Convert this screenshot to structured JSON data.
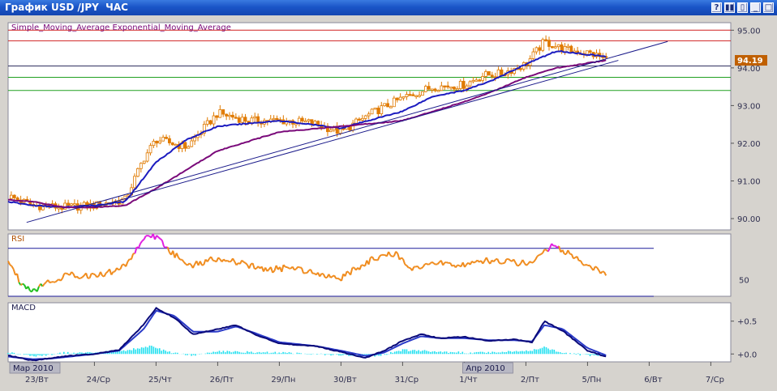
{
  "window": {
    "title": "График USD /JPY  ЧАС",
    "buttons": [
      {
        "name": "help-button",
        "glyph": "?"
      },
      {
        "name": "pause-button",
        "glyph": "▮▮"
      },
      {
        "name": "tile-button",
        "glyph": "▯"
      },
      {
        "name": "minimize-button",
        "glyph": "_"
      },
      {
        "name": "maximize-button",
        "glyph": "□"
      },
      {
        "name": "close-button",
        "glyph": "×"
      }
    ]
  },
  "price_panel": {
    "legend": "Simple_Moving_Average Exponential_Moving_Average",
    "current_price": "94.19",
    "y_ticks": [
      "95.00",
      "94.00",
      "93.00",
      "92.00",
      "91.00",
      "90.00"
    ]
  },
  "rsi_panel": {
    "label": "RSI",
    "y_ticks": [
      "50"
    ]
  },
  "macd_panel": {
    "label": "MACD",
    "y_ticks": [
      "+0.5",
      "+0.0"
    ]
  },
  "x_axis": {
    "labels": [
      "23/Вт",
      "24/Ср",
      "25/Чт",
      "26/Пт",
      "29/Пн",
      "30/Вт",
      "31/Ср",
      "1/Чт",
      "2/Пт",
      "5/Пн",
      "6/Вт",
      "7/Ср"
    ],
    "month_flags": [
      "Мар 2010",
      "Апр 2010"
    ]
  },
  "colors": {
    "background": "#ffffff",
    "candle": "#e07a00",
    "sma": "#1c1cc0",
    "ema": "#7a0a7a",
    "trendline": "#1a1a8a",
    "resistance": "#d02020",
    "support": "#20a020",
    "rsi_line": "#f08c1e",
    "rsi_high": "#e020e0",
    "rsi_low": "#20c020",
    "macd_line": "#0a0a7a",
    "signal_line": "#2a3ac8",
    "histogram": "#22e0f0",
    "price_badge": "#c06000"
  },
  "chart_data": [
    {
      "type": "candlestick",
      "title": "Simple_Moving_Average Exponential_Moving_Average",
      "ylim": [
        89.7,
        95.2
      ],
      "x": [
        "23/Вт",
        "24/Ср",
        "25/Чт",
        "26/Пт",
        "29/Пн",
        "30/Вт",
        "31/Ср",
        "1/Чт",
        "2/Пт",
        "5/Пн",
        "6/Вт"
      ],
      "series": [
        {
          "values": [
            90.35,
            90.3,
            91.9,
            92.9,
            92.6,
            92.4,
            93.2,
            93.55,
            93.95,
            94.65,
            94.25
          ]
        },
        {
          "values": [
            90.4,
            90.3,
            91.5,
            92.45,
            92.6,
            92.4,
            92.85,
            93.4,
            93.7,
            94.45,
            94.3
          ]
        },
        {
          "values": [
            90.55,
            90.3,
            90.8,
            91.8,
            92.3,
            92.45,
            92.6,
            93.1,
            93.4,
            93.95,
            94.2
          ]
        }
      ],
      "horizontal_levels": [
        95.0,
        94.72,
        94.05,
        93.75,
        93.4
      ],
      "trendline": [
        [
          22.9,
          89.9
        ],
        [
          28.6,
          94.7
        ]
      ],
      "last": 94.19
    },
    {
      "type": "line",
      "title": "RSI",
      "ylim": [
        30,
        82
      ],
      "levels": [
        70,
        30
      ],
      "x": [
        "23/Вт",
        "24/Ср",
        "25/Чт",
        "26/Пт",
        "29/Пн",
        "30/Вт",
        "31/Ср",
        "1/Чт",
        "2/Пт",
        "5/Пн",
        "6/Вт"
      ],
      "series": [
        {
          "values": [
            66,
            48,
            58,
            82,
            54,
            48,
            60,
            58,
            60,
            72,
            45
          ]
        }
      ]
    },
    {
      "type": "line",
      "title": "MACD",
      "ylim": [
        -0.12,
        0.78
      ],
      "x": [
        "23/Вт",
        "24/Ср",
        "25/Чт",
        "26/Пт",
        "29/Пн",
        "30/Вт",
        "31/Ср",
        "1/Чт",
        "2/Пт",
        "5/Пн",
        "6/Вт"
      ],
      "series": [
        {
          "values": [
            -0.05,
            0.02,
            0.68,
            0.4,
            0.18,
            0.05,
            0.25,
            0.22,
            0.2,
            0.48,
            0.0
          ]
        },
        {
          "values": [
            -0.08,
            0.0,
            0.64,
            0.38,
            0.17,
            0.06,
            0.22,
            0.21,
            0.2,
            0.44,
            0.02
          ]
        },
        {
          "values": [
            0.05,
            0.02,
            0.12,
            0.04,
            0.02,
            -0.03,
            0.06,
            0.03,
            0.02,
            0.1,
            -0.03
          ]
        }
      ]
    }
  ]
}
